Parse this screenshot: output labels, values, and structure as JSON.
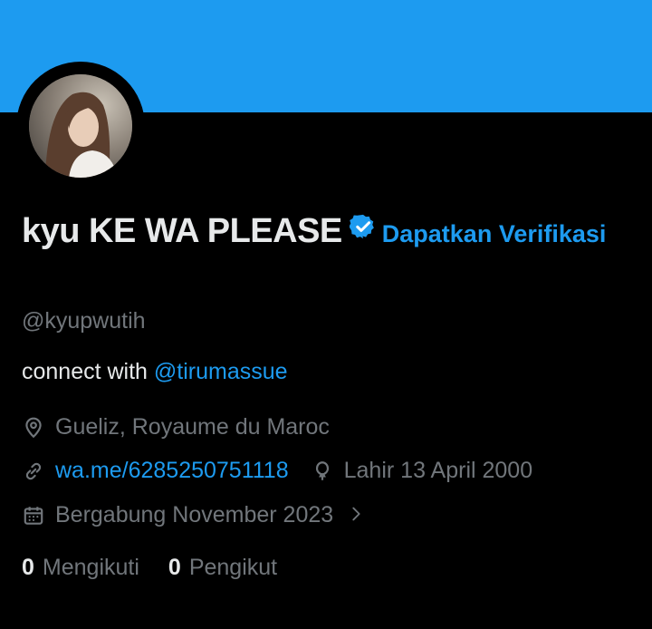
{
  "profile": {
    "display_name": "kyu KE WA PLEASE",
    "verify_cta": "Dapatkan Verifikasi",
    "handle": "@kyupwutih",
    "bio_text": "connect with ",
    "bio_mention": "@tirumassue",
    "location": "Gueliz, Royaume du Maroc",
    "website": "wa.me/6285250751118",
    "birthday": "Lahir 13 April 2000",
    "joined": "Bergabung November 2023",
    "following_count": "0",
    "following_label": "Mengikuti",
    "followers_count": "0",
    "followers_label": "Pengikut"
  },
  "colors": {
    "banner": "#1d9bf0",
    "accent": "#1d9bf0",
    "background": "#000000",
    "primary_text": "#e7e9ea",
    "secondary_text": "#71767b"
  },
  "icons": [
    "verified-badge-icon",
    "location-icon",
    "link-icon",
    "birthday-icon",
    "calendar-icon",
    "chevron-right-icon"
  ]
}
